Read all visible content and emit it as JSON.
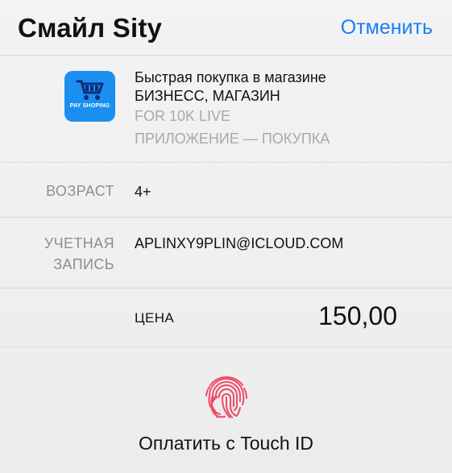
{
  "header": {
    "title": "Смайл Sity",
    "cancel_label": "Отменить"
  },
  "product": {
    "icon_name": "pay-shopping-cart-icon",
    "icon_text": "PAY SHOPING",
    "icon_color": "#1a8ff0",
    "name": "Быстрая покупка в магазине",
    "developer": "БИЗНЕСС, МАГАЗИН",
    "subtitle": "FOR 10K LIVE",
    "type": "ПРИЛОЖЕНИЕ — ПОКУПКА"
  },
  "details": {
    "age_label": "ВОЗРАСТ",
    "age_value": "4+",
    "account_label_line1": "УЧЕТНАЯ",
    "account_label_line2": "ЗАПИСЬ",
    "account_value": "APLINXY9PLIN@ICLOUD.COM",
    "price_label": "ЦЕНА",
    "price_value": "150,00"
  },
  "touch_id": {
    "icon_name": "fingerprint-icon",
    "label": "Оплатить с Touch ID",
    "accent_color": "#f04a64"
  },
  "colors": {
    "link": "#1a7ef5",
    "secondary_text": "#8e8e93",
    "separator": "#d8d8da"
  }
}
